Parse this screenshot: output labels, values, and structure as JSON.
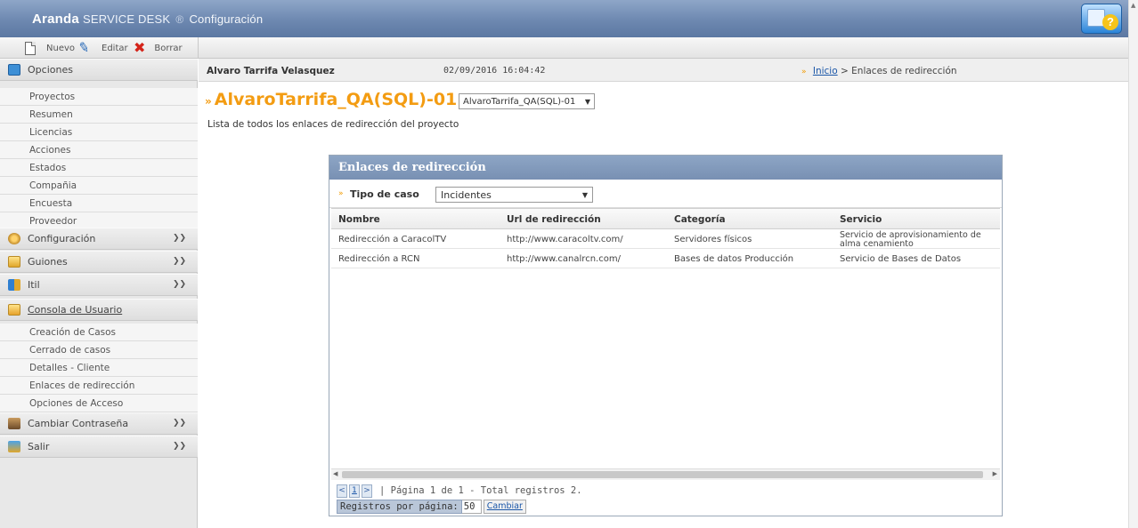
{
  "app": {
    "brand_name": "Aranda",
    "product": "SERVICE DESK",
    "separator": "®",
    "module": "Configuración"
  },
  "toolbar": {
    "new_label": "Nuevo",
    "edit_label": "Editar",
    "delete_label": "Borrar"
  },
  "sidebar": {
    "opciones": {
      "label": "Opciones",
      "items": [
        "Proyectos",
        "Resumen",
        "Licencias",
        "Acciones",
        "Estados",
        "Compañia",
        "Encuesta",
        "Proveedor"
      ]
    },
    "configuracion_label": "Configuración",
    "guiones_label": "Guiones",
    "itil_label": "Itil",
    "consola": {
      "label": "Consola de Usuario",
      "items": [
        "Creación de Casos",
        "Cerrado de casos",
        "Detalles - Cliente",
        "Enlaces de redirección",
        "Opciones de Acceso"
      ]
    },
    "cambiar_label": "Cambiar Contraseña",
    "salir_label": "Salir"
  },
  "header": {
    "user": "Alvaro Tarrifa Velasquez",
    "datetime": "02/09/2016 16:04:42",
    "breadcrumb_home": "Inicio",
    "breadcrumb_sep": ">",
    "breadcrumb_current": "Enlaces de redirección"
  },
  "project": {
    "title": "AlvaroTarrifa_QA(SQL)-01",
    "selected": "AlvaroTarrifa_QA(SQL)-01",
    "description": "Lista de todos los enlaces de redirección del proyecto"
  },
  "panel": {
    "title": "Enlaces de redirección",
    "filter_label": "Tipo de caso",
    "filter_value": "Incidentes",
    "columns": [
      "Nombre",
      "Url de redirección",
      "Categoría",
      "Servicio"
    ],
    "rows": [
      [
        "Redirección a CaracolTV",
        "http://www.caracoltv.com/",
        "Servidores físicos",
        "Servicio de aprovisionamiento de alma cenamiento"
      ],
      [
        "Redirección a RCN",
        "http://www.canalrcn.com/",
        "Bases de datos Producción",
        "Servicio de Bases de Datos"
      ]
    ],
    "pager": {
      "prev": "<",
      "page": "1",
      "next": ">",
      "info": "| Página 1 de 1 - Total registros 2.",
      "per_page_label": "Registros por página:",
      "per_page_value": "50",
      "change_label": "Cambiar"
    }
  }
}
